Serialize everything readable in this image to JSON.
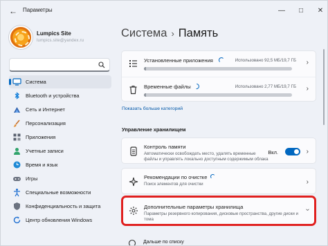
{
  "window": {
    "title": "Параметры",
    "controls": {
      "minimize": "—",
      "maximize": "□",
      "close": "✕"
    }
  },
  "profile": {
    "name": "Lumpics Site",
    "email": "lumpics.site@yandex.ru"
  },
  "search": {
    "value": "",
    "placeholder": ""
  },
  "sidebar": {
    "items": [
      {
        "label": "Система",
        "icon": "monitor-icon",
        "active": true
      },
      {
        "label": "Bluetooth и устройства",
        "icon": "bluetooth-icon"
      },
      {
        "label": "Сеть и Интернет",
        "icon": "wifi-icon"
      },
      {
        "label": "Персонализация",
        "icon": "brush-icon"
      },
      {
        "label": "Приложения",
        "icon": "apps-icon"
      },
      {
        "label": "Учетные записи",
        "icon": "user-icon"
      },
      {
        "label": "Время и язык",
        "icon": "globe-clock-icon"
      },
      {
        "label": "Игры",
        "icon": "gamepad-icon"
      },
      {
        "label": "Специальные возможности",
        "icon": "accessibility-icon"
      },
      {
        "label": "Конфиденциальность и защита",
        "icon": "shield-icon"
      },
      {
        "label": "Центр обновления Windows",
        "icon": "update-icon"
      }
    ]
  },
  "breadcrumb": {
    "parent": "Система",
    "current": "Память"
  },
  "storage": {
    "installed_apps": {
      "label": "Установленные приложения",
      "used": "Использовано 92,5 МБ/19,7 ГБ",
      "fill": 0.005
    },
    "temp_files": {
      "label": "Временные файлы",
      "used": "Использовано 2,77 МБ/19,7 ГБ",
      "fill": 0.003
    }
  },
  "more_categories": "Показать больше категорий",
  "management": {
    "title": "Управление хранилищем",
    "storage_sense": {
      "title": "Контроль памяти",
      "desc": "Автоматически освобождать место, удалять временные файлы и управлять локально доступным содержимым облака",
      "toggle_label": "Вкл.",
      "enabled": true
    },
    "cleanup": {
      "title": "Рекомендации по очистке",
      "desc": "Поиск элементов для очистки"
    },
    "advanced": {
      "title": "Дополнительные параметры хранилища",
      "desc": "Параметры резервного копирования, дисковые пространства, другие диски и тома"
    },
    "next_partial": "Дальше по списку"
  },
  "colors": {
    "accent": "#0067c0",
    "highlight": "#e0201f"
  }
}
